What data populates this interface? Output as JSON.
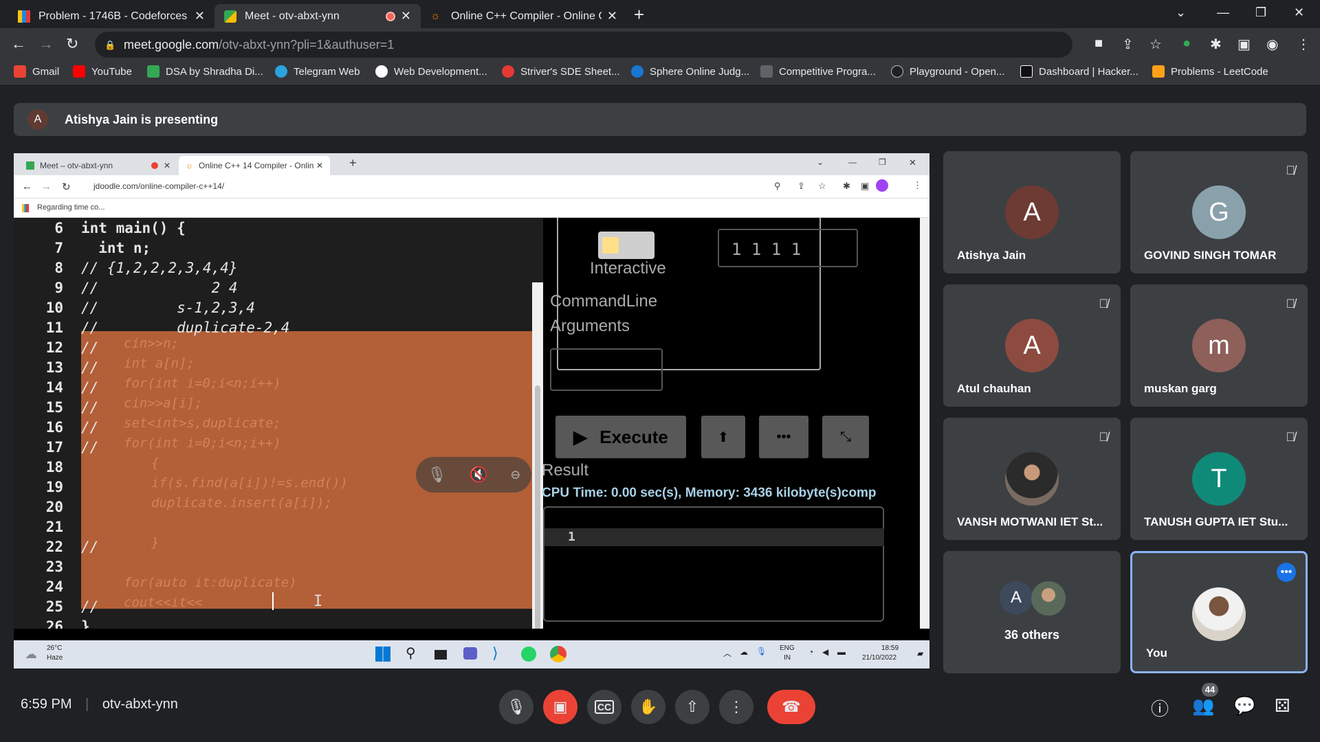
{
  "browser": {
    "tabs": [
      {
        "title": "Problem - 1746B - Codeforces"
      },
      {
        "title": "Meet - otv-abxt-ynn"
      },
      {
        "title": "Online C++ Compiler - Online C"
      }
    ],
    "url_host": "meet.google.com",
    "url_path": "/otv-abxt-ynn?pli=1&authuser=1",
    "bookmarks": [
      "Gmail",
      "YouTube",
      "DSA by Shradha Di...",
      "Telegram Web",
      "Web Development...",
      "Striver's SDE Sheet...",
      "Sphere Online Judg...",
      "Competitive Progra...",
      "Playground - Open...",
      "Dashboard | Hacker...",
      "Problems - LeetCode"
    ]
  },
  "presenting": {
    "initial": "A",
    "text": "Atishya Jain is presenting"
  },
  "shared_screen": {
    "tabs": [
      {
        "title": "Meet – otv-abxt-ynn"
      },
      {
        "title": "Online C++ 14 Compiler - Onlin"
      }
    ],
    "url": "jdoodle.com/online-compiler-c++14/",
    "bookmark": "Regarding time co...",
    "code_lines": [
      {
        "n": "6",
        "t": "int main() {"
      },
      {
        "n": "7",
        "t": "  int n;"
      },
      {
        "n": "8",
        "t": "// {1,2,2,2,3,4,4}"
      },
      {
        "n": "9",
        "t": "//             2 4"
      },
      {
        "n": "10",
        "t": "//         s-1,2,3,4"
      },
      {
        "n": "11",
        "t": "//         duplicate-2,4"
      },
      {
        "n": "12",
        "t": "//"
      },
      {
        "n": "13",
        "t": "//"
      },
      {
        "n": "14",
        "t": "//"
      },
      {
        "n": "15",
        "t": "//"
      },
      {
        "n": "16",
        "t": "//"
      },
      {
        "n": "17",
        "t": "//"
      },
      {
        "n": "18",
        "t": ""
      },
      {
        "n": "19",
        "t": ""
      },
      {
        "n": "20",
        "t": ""
      },
      {
        "n": "21",
        "t": ""
      },
      {
        "n": "22",
        "t": "//"
      },
      {
        "n": "23",
        "t": ""
      },
      {
        "n": "24",
        "t": ""
      },
      {
        "n": "25",
        "t": "//"
      },
      {
        "n": "26",
        "t": "}"
      }
    ],
    "selected_code": [
      "cin>>n;",
      "int a[n];",
      "for(int i=0;i<n;i++)",
      "cin>>a[i];",
      "set<int>s,duplicate;",
      "for(int i=0;i<n;i++)",
      "{",
      "if(s.find(a[i])!=s.end())",
      "duplicate.insert(a[i]);",
      "",
      "}",
      "",
      "for(auto it:duplicate)",
      "cout<<it<<"
    ],
    "stdin_value": "1 1 1 1",
    "interactive_label": "Interactive",
    "cmd_label_1": "CommandLine",
    "cmd_label_2": "Arguments",
    "execute_label": "Execute",
    "result_label": "Result",
    "cpu_text": "CPU Time: 0.00 sec(s), Memory: 3436 kilobyte(s)comp",
    "output": "1",
    "weather_temp": "26°C",
    "weather_desc": "Haze",
    "lang": "ENG",
    "region": "IN",
    "clock_time": "18:59",
    "clock_date": "21/10/2022"
  },
  "participants": [
    {
      "initial": "A",
      "name": "Atishya Jain",
      "color": "#6d3b33",
      "muted": false
    },
    {
      "initial": "G",
      "name": "GOVIND SINGH TOMAR",
      "color": "#8aa1ac",
      "muted": true
    },
    {
      "initial": "A",
      "name": "Atul chauhan",
      "color": "#8d4b40",
      "muted": true
    },
    {
      "initial": "m",
      "name": "muskan garg",
      "color": "#8f5f5a",
      "muted": true
    },
    {
      "initial": "",
      "name": "VANSH MOTWANI IET St...",
      "color": "#6a5a4e",
      "muted": true
    },
    {
      "initial": "T",
      "name": "TANUSH GUPTA IET Stu...",
      "color": "#0f8a78",
      "muted": true
    }
  ],
  "others": {
    "initial": "A",
    "label": "36 others"
  },
  "self": {
    "name": "You"
  },
  "meeting": {
    "time": "6:59 PM",
    "code": "otv-abxt-ynn",
    "people_count": "44"
  },
  "colors": {
    "accent": "#8ab4f8",
    "end_call": "#ea4335"
  }
}
